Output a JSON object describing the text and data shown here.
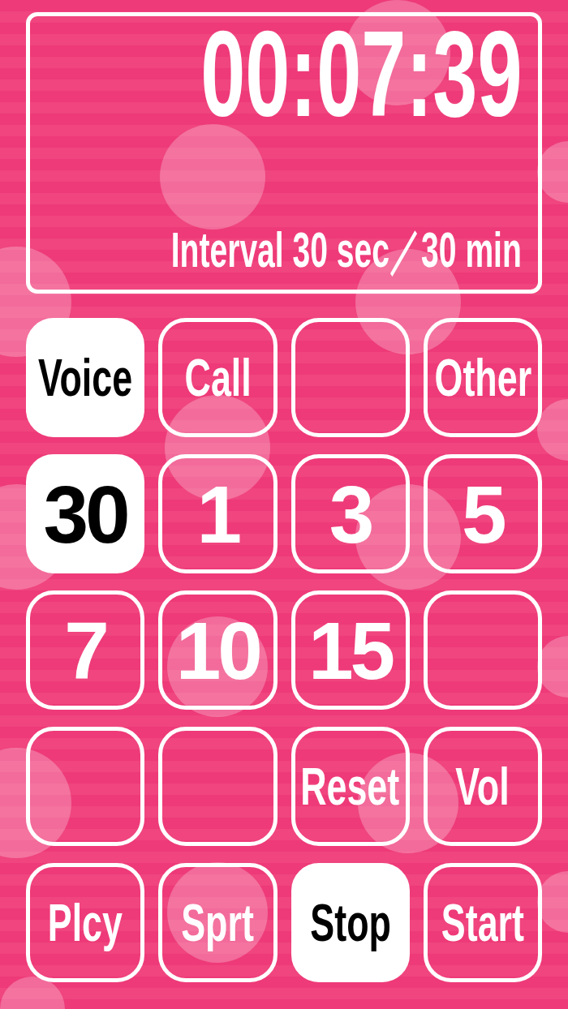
{
  "display": {
    "time": "00:07:39",
    "interval": "Interval 30 sec／30 min"
  },
  "buttons": [
    {
      "kind": "word",
      "label": "Voice",
      "selected": true
    },
    {
      "kind": "word",
      "label": "Call",
      "selected": false
    },
    {
      "kind": "blank",
      "selected": false
    },
    {
      "kind": "word",
      "label": "Other",
      "selected": false
    },
    {
      "kind": "number",
      "label": "30",
      "selected": true
    },
    {
      "kind": "number",
      "label": "1",
      "selected": false
    },
    {
      "kind": "number",
      "label": "3",
      "selected": false
    },
    {
      "kind": "number",
      "label": "5",
      "selected": false
    },
    {
      "kind": "number",
      "label": "7",
      "selected": false
    },
    {
      "kind": "number",
      "label": "10",
      "selected": false
    },
    {
      "kind": "number",
      "label": "15",
      "selected": false
    },
    {
      "kind": "blank",
      "selected": false
    },
    {
      "kind": "blank",
      "selected": false
    },
    {
      "kind": "blank",
      "selected": false
    },
    {
      "kind": "word",
      "label": "Reset",
      "selected": false
    },
    {
      "kind": "word",
      "label": "Vol",
      "selected": false
    },
    {
      "kind": "word",
      "label": "Plcy",
      "selected": false
    },
    {
      "kind": "word",
      "label": "Sprt",
      "selected": false
    },
    {
      "kind": "word",
      "label": "Stop",
      "selected": true
    },
    {
      "kind": "word",
      "label": "Start",
      "selected": false
    }
  ]
}
